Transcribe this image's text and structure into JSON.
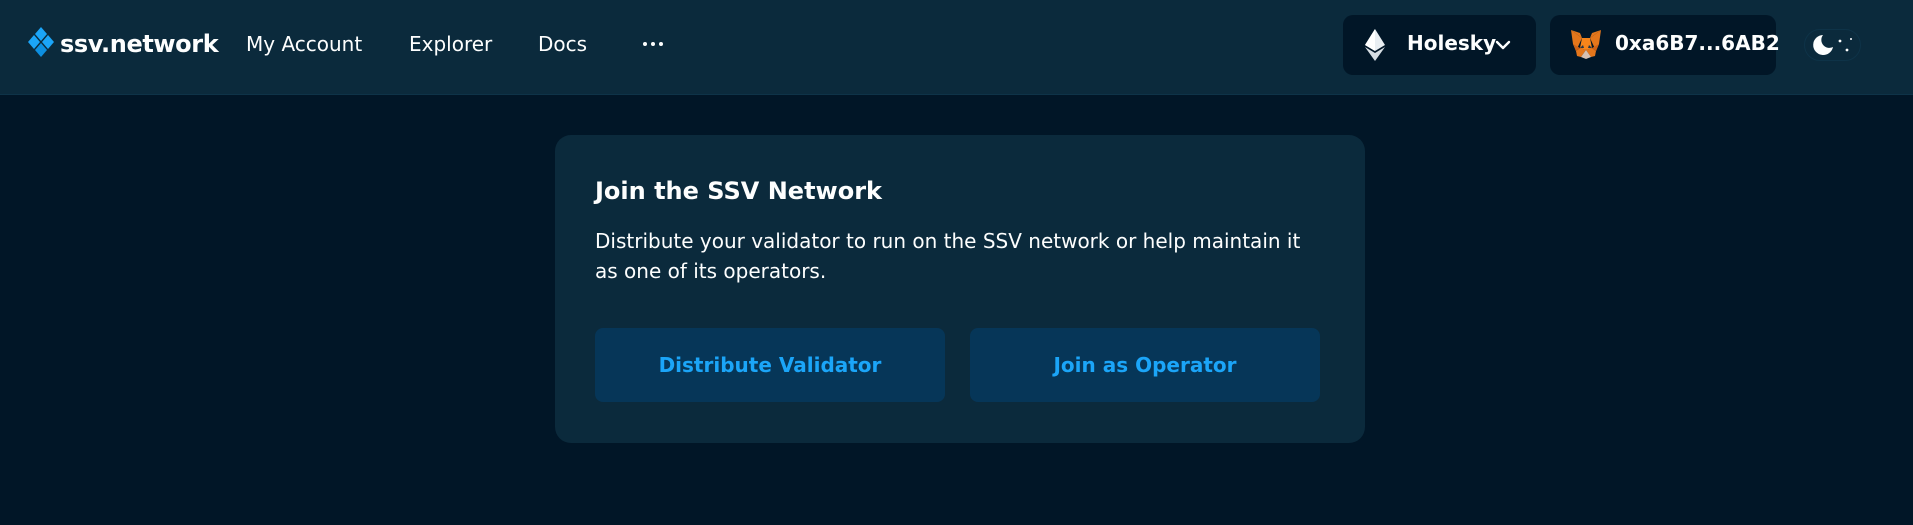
{
  "header": {
    "logo_text": "ssv.network",
    "nav": [
      {
        "label": "My Account"
      },
      {
        "label": "Explorer"
      },
      {
        "label": "Docs"
      }
    ],
    "more_icon": "ellipsis-icon",
    "network": {
      "label": "Holesky",
      "icon": "ethereum-icon"
    },
    "wallet": {
      "address": "0xa6B7...6AB2",
      "icon": "metamask-fox-icon"
    },
    "theme_toggle": {
      "icon": "moon-icon",
      "mode": "dark"
    }
  },
  "card": {
    "title": "Join the SSV Network",
    "description": "Distribute your validator to run on the SSV network or help maintain it as one of its operators.",
    "buttons": [
      {
        "label": "Distribute Validator"
      },
      {
        "label": "Join as Operator"
      }
    ]
  },
  "colors": {
    "background": "#011627",
    "header_bg": "#0b2a3c",
    "card_bg": "#0b2a3c",
    "button_bg": "#063658",
    "accent": "#1ba5f8",
    "text": "#fdfefe"
  }
}
